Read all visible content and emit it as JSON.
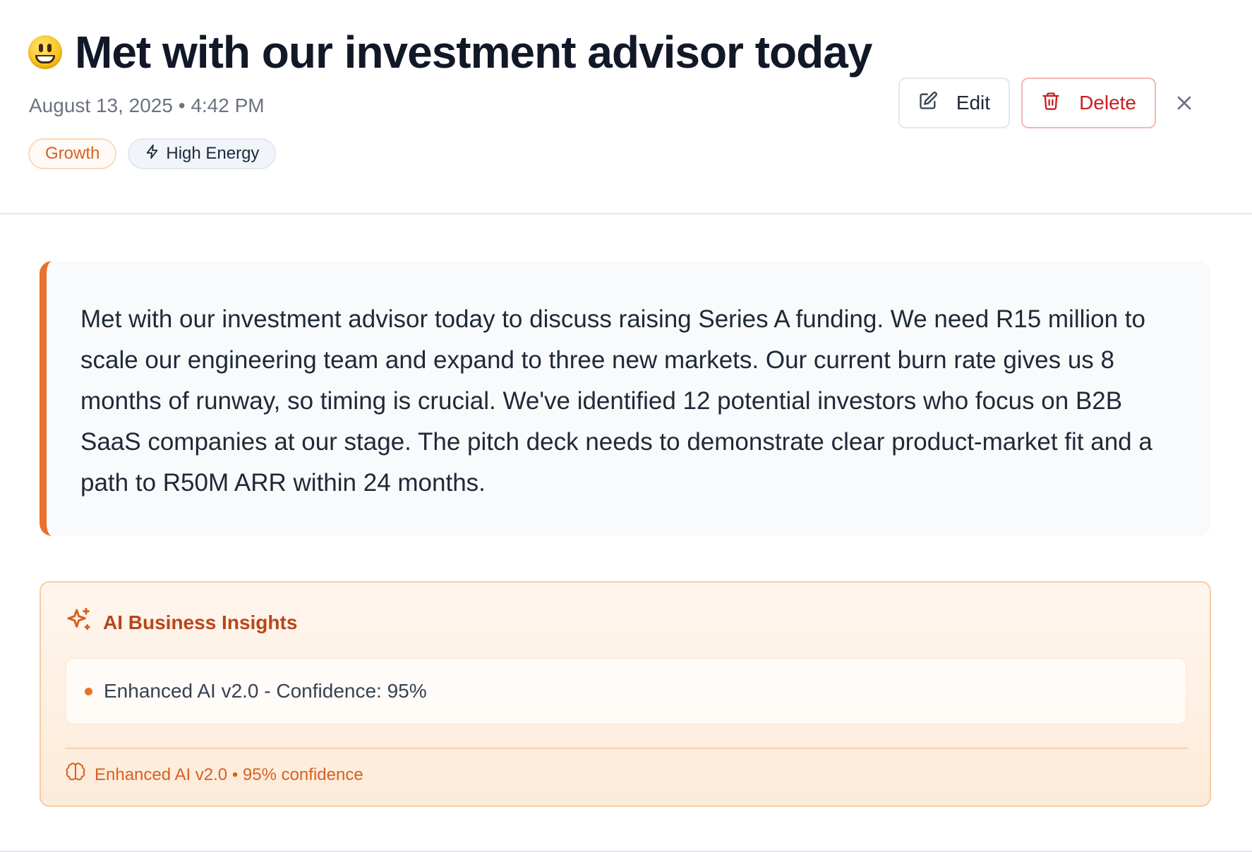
{
  "entry": {
    "mood_icon": "grinning-face-emoji",
    "title": "Met with our investment advisor today",
    "date": "August 13, 2025",
    "separator": "•",
    "time": "4:42 PM",
    "tags": {
      "category": "Growth",
      "energy": "High Energy",
      "energy_icon": "lightning-icon"
    },
    "body": "Met with our investment advisor today to discuss raising Series A funding. We need R15 million to scale our engineering team and expand to three new markets. Our current burn rate gives us 8 months of runway, so timing is crucial. We've identified 12 potential investors who focus on B2B SaaS companies at our stage. The pitch deck needs to demonstrate clear product-market fit and a path to R50M ARR within 24 months."
  },
  "toolbar": {
    "edit_label": "Edit",
    "edit_icon": "pencil-square-icon",
    "delete_label": "Delete",
    "delete_icon": "trash-icon",
    "close_icon": "close-icon"
  },
  "insights": {
    "icon": "sparkles-icon",
    "title": "AI Business Insights",
    "items": [
      "Enhanced AI v2.0 - Confidence: 95%"
    ],
    "footer_icon": "brain-icon",
    "footer": "Enhanced AI v2.0 • 95% confidence"
  },
  "colors": {
    "accent": "#e8712c",
    "title_text": "#111827",
    "danger": "#c81e1e",
    "insight_title": "#b8451b",
    "muted_text": "#6b7280"
  }
}
